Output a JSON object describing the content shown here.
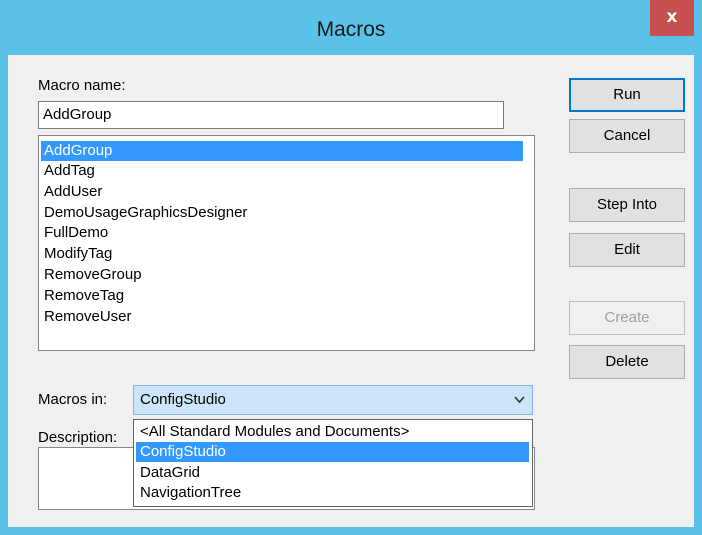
{
  "window": {
    "title": "Macros",
    "close_symbol": "x"
  },
  "labels": {
    "macro_name": "Macro name:",
    "macros_in": "Macros in:",
    "description": "Description:"
  },
  "macro_name_input": {
    "value": "AddGroup"
  },
  "macro_list": {
    "selected": "AddGroup",
    "items": [
      "AddGroup",
      "AddTag",
      "AddUser",
      "DemoUsageGraphicsDesigner",
      "FullDemo",
      "ModifyTag",
      "RemoveGroup",
      "RemoveTag",
      "RemoveUser"
    ]
  },
  "buttons": {
    "run": "Run",
    "cancel": "Cancel",
    "step_into": "Step Into",
    "edit": "Edit",
    "create": "Create",
    "delete": "Delete"
  },
  "macros_in_select": {
    "value": "ConfigStudio",
    "options": [
      "<All Standard Modules and Documents>",
      "ConfigStudio",
      "DataGrid",
      "NavigationTree"
    ],
    "selected_option": "ConfigStudio"
  },
  "colors": {
    "title_bar": "#5ac2e8",
    "close_button": "#c75050",
    "selection": "#3399ff",
    "dialog_bg": "#f0f0f0"
  }
}
